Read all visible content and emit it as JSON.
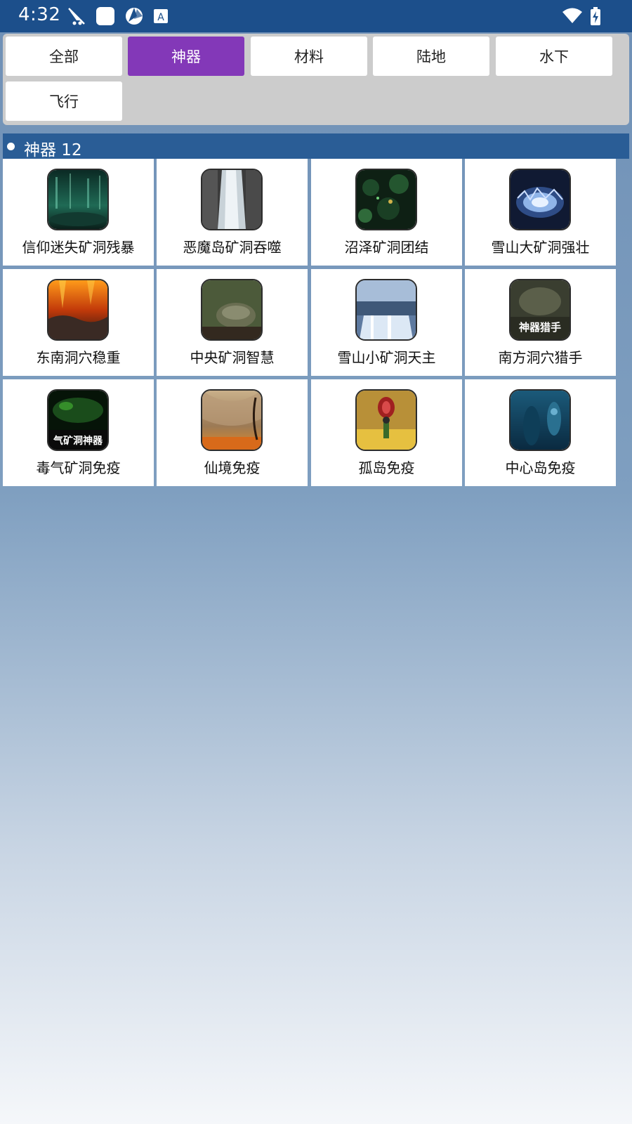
{
  "status_bar": {
    "time": "4:32",
    "icons": [
      "no-signal-satellite-icon",
      "app-square-icon",
      "aperture-icon",
      "text-a-icon",
      "wifi-icon",
      "battery-charging-icon"
    ]
  },
  "filters": {
    "active": "神器",
    "items": [
      {
        "label": "全部"
      },
      {
        "label": "神器"
      },
      {
        "label": "材料"
      },
      {
        "label": "陆地"
      },
      {
        "label": "水下"
      },
      {
        "label": "飞行"
      }
    ]
  },
  "section": {
    "title": "神器 12"
  },
  "items": [
    {
      "label": "信仰迷失矿洞残暴",
      "thumb": "green-cave-image"
    },
    {
      "label": "恶魔岛矿洞吞噬",
      "thumb": "waterfall-image"
    },
    {
      "label": "沼泽矿洞团结",
      "thumb": "swamp-cave-image"
    },
    {
      "label": "雪山大矿洞强壮",
      "thumb": "ice-cave-image"
    },
    {
      "label": "东南洞穴稳重",
      "thumb": "lava-cave-image"
    },
    {
      "label": "中央矿洞智慧",
      "thumb": "rock-cave-image"
    },
    {
      "label": "雪山小矿洞天主",
      "thumb": "snow-waterfall-image"
    },
    {
      "label": "南方洞穴猎手",
      "thumb": "hunter-cave-image",
      "thumb_text": "神器猎手"
    },
    {
      "label": "毒气矿洞免疫",
      "thumb": "toxic-cave-image",
      "thumb_text": "气矿洞神器"
    },
    {
      "label": "仙境免疫",
      "thumb": "wonderland-image"
    },
    {
      "label": "孤岛免疫",
      "thumb": "island-image"
    },
    {
      "label": "中心岛免疫",
      "thumb": "underwater-image"
    }
  ],
  "colors": {
    "status_bar": "#1c4f8b",
    "active_filter": "#8338b8",
    "section_header": "#2a5d96"
  }
}
